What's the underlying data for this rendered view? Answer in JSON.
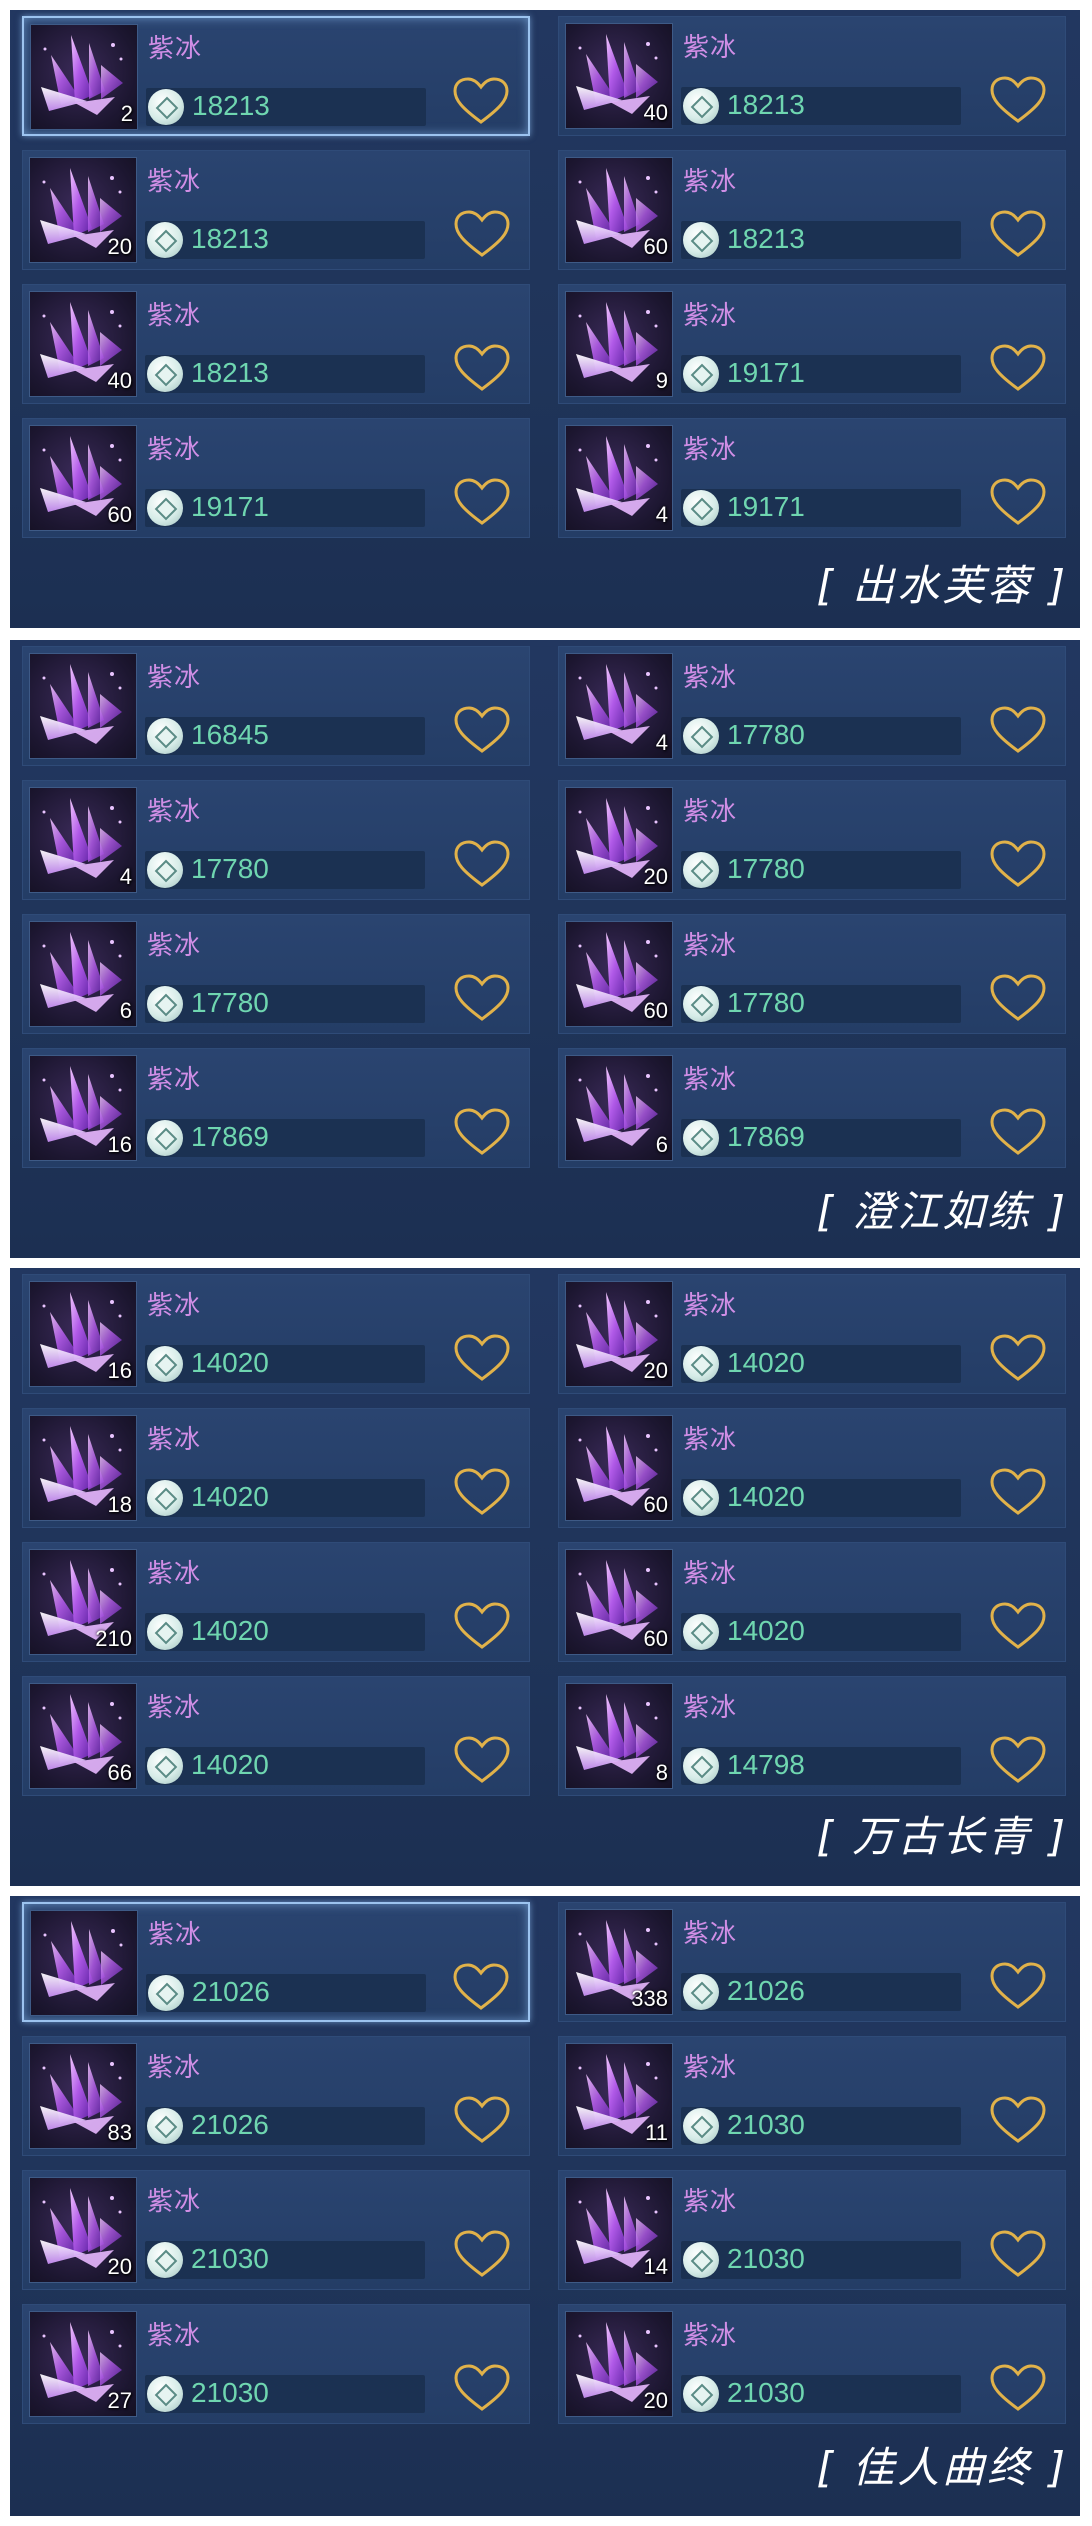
{
  "panels": [
    {
      "title": "出水芙蓉",
      "items": [
        {
          "name": "紫冰",
          "qty": "2",
          "price": "18213",
          "selected": true
        },
        {
          "name": "紫冰",
          "qty": "40",
          "price": "18213",
          "selected": false
        },
        {
          "name": "紫冰",
          "qty": "20",
          "price": "18213",
          "selected": false
        },
        {
          "name": "紫冰",
          "qty": "60",
          "price": "18213",
          "selected": false
        },
        {
          "name": "紫冰",
          "qty": "40",
          "price": "18213",
          "selected": false
        },
        {
          "name": "紫冰",
          "qty": "9",
          "price": "19171",
          "selected": false
        },
        {
          "name": "紫冰",
          "qty": "60",
          "price": "19171",
          "selected": false
        },
        {
          "name": "紫冰",
          "qty": "4",
          "price": "19171",
          "selected": false
        }
      ]
    },
    {
      "title": "澄江如练",
      "items": [
        {
          "name": "紫冰",
          "qty": "",
          "price": "16845",
          "selected": false
        },
        {
          "name": "紫冰",
          "qty": "4",
          "price": "17780",
          "selected": false
        },
        {
          "name": "紫冰",
          "qty": "4",
          "price": "17780",
          "selected": false
        },
        {
          "name": "紫冰",
          "qty": "20",
          "price": "17780",
          "selected": false
        },
        {
          "name": "紫冰",
          "qty": "6",
          "price": "17780",
          "selected": false
        },
        {
          "name": "紫冰",
          "qty": "60",
          "price": "17780",
          "selected": false
        },
        {
          "name": "紫冰",
          "qty": "16",
          "price": "17869",
          "selected": false
        },
        {
          "name": "紫冰",
          "qty": "6",
          "price": "17869",
          "selected": false
        }
      ]
    },
    {
      "title": "万古长青",
      "items": [
        {
          "name": "紫冰",
          "qty": "16",
          "price": "14020",
          "selected": false
        },
        {
          "name": "紫冰",
          "qty": "20",
          "price": "14020",
          "selected": false
        },
        {
          "name": "紫冰",
          "qty": "18",
          "price": "14020",
          "selected": false
        },
        {
          "name": "紫冰",
          "qty": "60",
          "price": "14020",
          "selected": false
        },
        {
          "name": "紫冰",
          "qty": "210",
          "price": "14020",
          "selected": false
        },
        {
          "name": "紫冰",
          "qty": "60",
          "price": "14020",
          "selected": false
        },
        {
          "name": "紫冰",
          "qty": "66",
          "price": "14020",
          "selected": false
        },
        {
          "name": "紫冰",
          "qty": "8",
          "price": "14798",
          "selected": false
        }
      ]
    },
    {
      "title": "佳人曲终",
      "items": [
        {
          "name": "紫冰",
          "qty": "",
          "price": "21026",
          "selected": true
        },
        {
          "name": "紫冰",
          "qty": "338",
          "price": "21026",
          "selected": false
        },
        {
          "name": "紫冰",
          "qty": "83",
          "price": "21026",
          "selected": false
        },
        {
          "name": "紫冰",
          "qty": "11",
          "price": "21030",
          "selected": false
        },
        {
          "name": "紫冰",
          "qty": "20",
          "price": "21030",
          "selected": false
        },
        {
          "name": "紫冰",
          "qty": "14",
          "price": "21030",
          "selected": false
        },
        {
          "name": "紫冰",
          "qty": "27",
          "price": "21030",
          "selected": false
        },
        {
          "name": "紫冰",
          "qty": "20",
          "price": "21030",
          "selected": false
        }
      ]
    }
  ],
  "icons": {
    "item": "purple-crystal-icon",
    "currency": "silver-coin-icon",
    "favorite": "heart-outline-icon"
  },
  "colors": {
    "panel_bg": "#213660",
    "item_name": "#d08ee6",
    "price": "#6fd6b0",
    "heart": "#e1b24a",
    "title": "#ffffff"
  }
}
